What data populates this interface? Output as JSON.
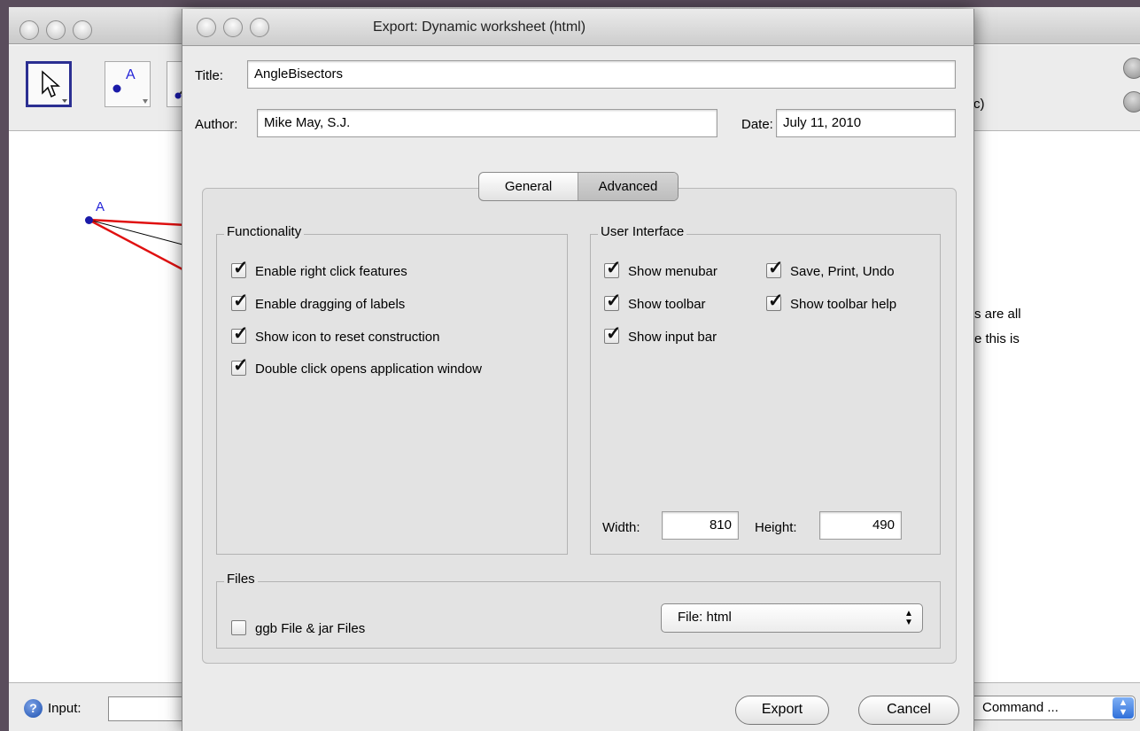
{
  "background_app": {
    "point_label": "A",
    "side_text_line1": "s are all",
    "side_text_line2": "e this is",
    "partial_text": "c)",
    "input_label": "Input:",
    "command_select_value": "Command ...",
    "point_tool_label": "A"
  },
  "dialog": {
    "title": "Export: Dynamic worksheet (html)",
    "title_label": "Title:",
    "title_value": "AngleBisectors",
    "author_label": "Author:",
    "author_value": "Mike May, S.J.",
    "date_label": "Date:",
    "date_value": "July 11, 2010",
    "tabs": [
      {
        "label": "General",
        "selected": false
      },
      {
        "label": "Advanced",
        "selected": true
      }
    ],
    "functionality": {
      "title": "Functionality",
      "items": [
        {
          "label": "Enable right click features",
          "checked": true
        },
        {
          "label": "Enable dragging of labels",
          "checked": true
        },
        {
          "label": "Show icon to reset construction",
          "checked": true
        },
        {
          "label": "Double click opens application window",
          "checked": true
        }
      ]
    },
    "user_interface": {
      "title": "User Interface",
      "items": [
        {
          "label": "Show menubar",
          "checked": true
        },
        {
          "label": "Save, Print, Undo",
          "checked": true
        },
        {
          "label": "Show toolbar",
          "checked": true
        },
        {
          "label": "Show toolbar help",
          "checked": true
        },
        {
          "label": "Show input bar",
          "checked": true
        }
      ],
      "width_label": "Width:",
      "width_value": "810",
      "height_label": "Height:",
      "height_value": "490"
    },
    "files": {
      "title": "Files",
      "ggb_label": "ggb File & jar Files",
      "ggb_checked": false,
      "file_select_value": "File: html"
    },
    "export_label": "Export",
    "cancel_label": "Cancel"
  }
}
